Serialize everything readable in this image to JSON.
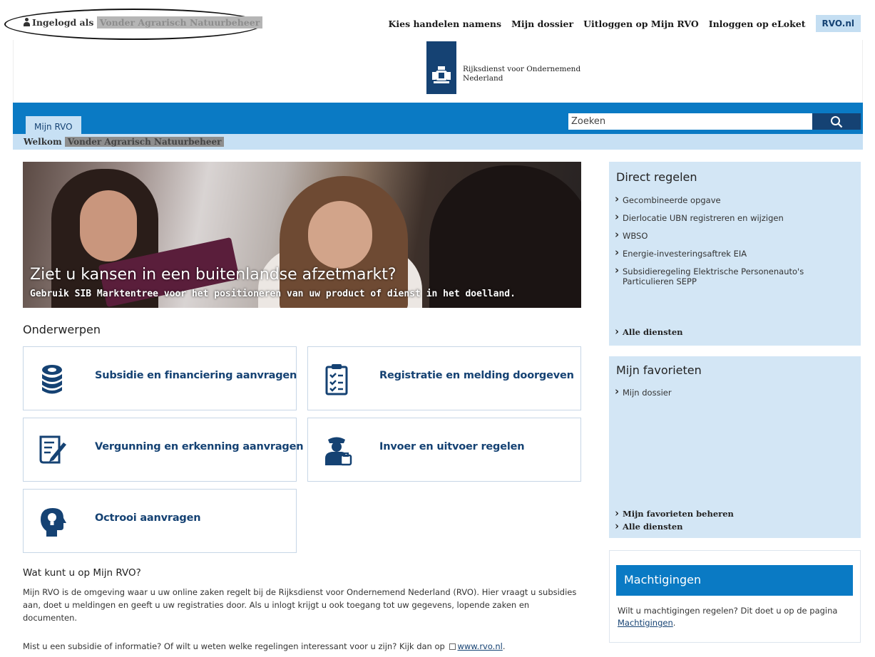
{
  "topbar": {
    "login_prefix": "Ingelogd als",
    "login_name": "Vonder Agrarisch Natuurbeheer",
    "links": [
      "Kies handelen namens",
      "Mijn dossier",
      "Uitloggen op Mijn RVO",
      "Inloggen op eLoket"
    ],
    "rvo_button": "RVO.nl"
  },
  "logo": {
    "line1": "Rijksdienst voor Ondernemend",
    "line2": "Nederland"
  },
  "nav": {
    "tab_label": "Mijn RVO",
    "search_placeholder": "Zoeken",
    "welcome_prefix": "Welkom",
    "welcome_name": "Vonder Agrarisch Natuurbeheer"
  },
  "hero": {
    "title": "Ziet u kansen in een buitenlandse afzetmarkt?",
    "subtitle": "Gebruik SIB Marktentree voor het positioneren van uw product of dienst in het doelland."
  },
  "onderwerpen": {
    "title": "Onderwerpen",
    "tiles": [
      {
        "label": "Subsidie en financiering aanvragen",
        "icon": "coins-icon"
      },
      {
        "label": "Registratie en melding doorgeven",
        "icon": "clipboard-checklist-icon"
      },
      {
        "label": "Vergunning en erkenning aanvragen",
        "icon": "document-pen-icon"
      },
      {
        "label": "Invoer en uitvoer regelen",
        "icon": "customs-officer-icon"
      },
      {
        "label": "Octrooi aanvragen",
        "icon": "head-lightbulb-icon"
      }
    ]
  },
  "wat": {
    "title": "Wat kunt u op Mijn RVO?",
    "p1": "Mijn RVO is de omgeving waar u uw online zaken regelt bij de Rijksdienst voor Ondernemend Nederland (RVO). Hier vraagt u subsidies aan, doet u meldingen en geeft u uw registraties door. Als u inlogt krijgt u ook toegang tot uw gegevens, lopende zaken en documenten.",
    "p2_text": "Mist u een subsidie of informatie? Of wilt u weten welke regelingen interessant voor u zijn? Kijk dan op",
    "p2_link": "www.rvo.nl",
    "p2_end": "."
  },
  "direct": {
    "title": "Direct regelen",
    "items": [
      "Gecombineerde opgave",
      "Dierlocatie UBN registreren en wijzigen",
      "WBSO",
      "Energie-investeringsaftrek EIA",
      "Subsidieregeling Elektrische Personenauto's Particulieren SEPP"
    ],
    "all_link": "Alle diensten"
  },
  "favorieten": {
    "title": "Mijn favorieten",
    "items": [
      "Mijn dossier"
    ],
    "manage_link": "Mijn favorieten beheren",
    "all_link": "Alle diensten"
  },
  "machtigingen": {
    "title": "Machtigingen",
    "text": "Wilt u machtigingen regelen? Dit doet u op de pagina",
    "link": "Machtigingen",
    "end": "."
  },
  "colors": {
    "rijks_blue": "#154273",
    "nav_blue": "#0a7ac4",
    "light_blue": "#c7e0f4",
    "panel_blue": "#d3e6f5"
  }
}
